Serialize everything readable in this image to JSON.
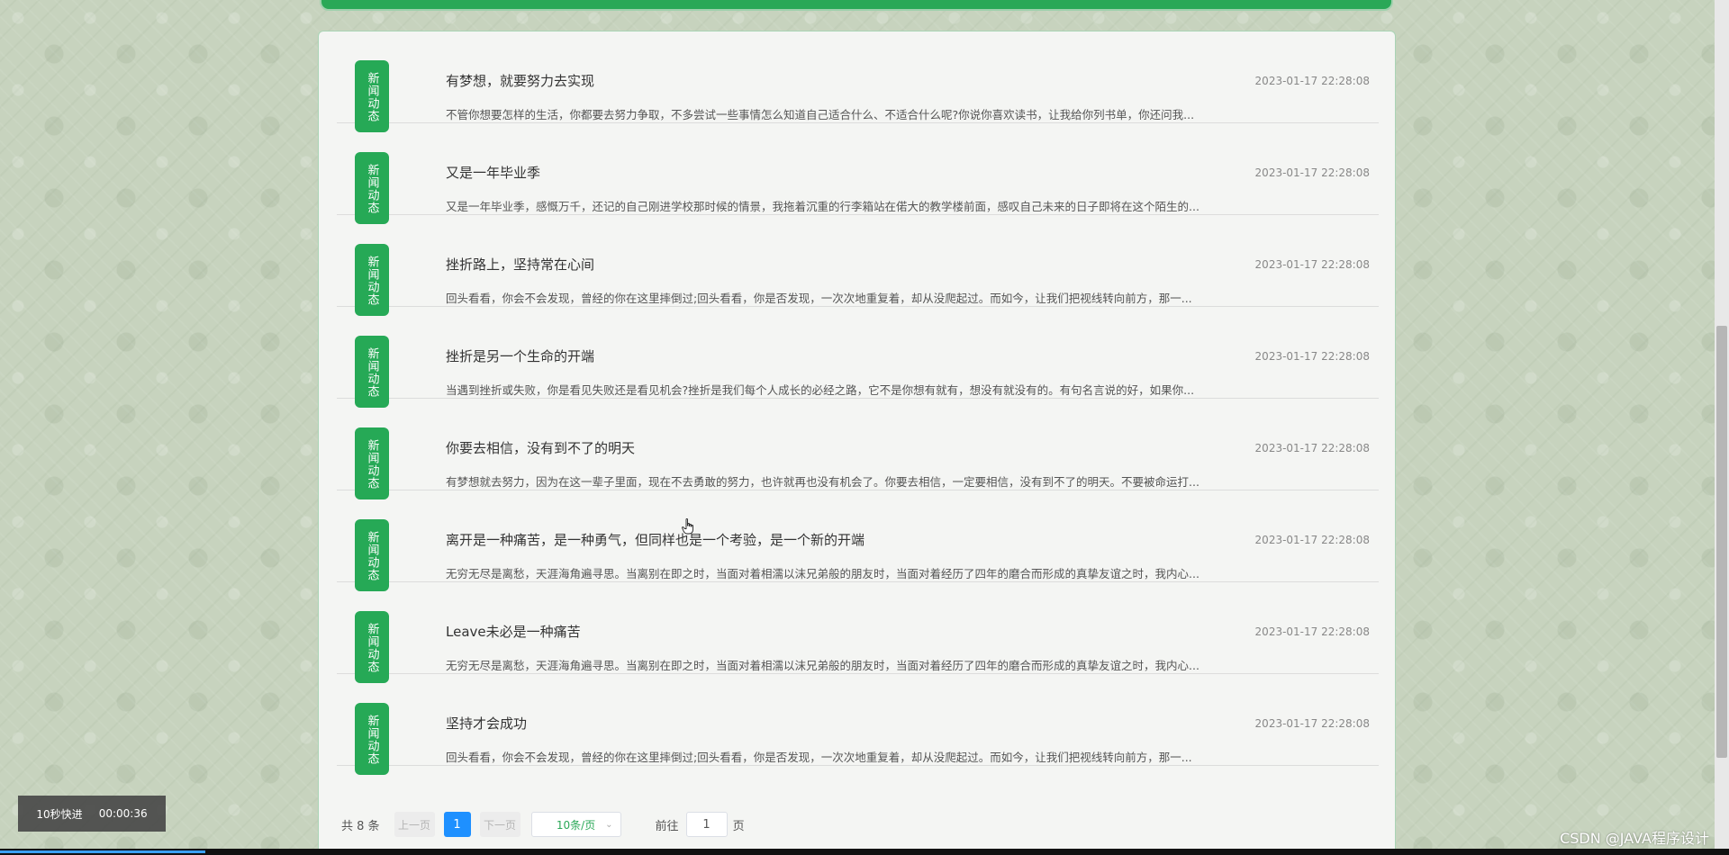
{
  "news": [
    {
      "badge": "新闻动态",
      "title": "有梦想，就要努力去实现",
      "date": "2023-01-17 22:28:08",
      "summary": "不管你想要怎样的生活，你都要去努力争取，不多尝试一些事情怎么知道自己适合什么、不适合什么呢?你说你喜欢读书，让我给你列书单，你还问我..."
    },
    {
      "badge": "新闻动态",
      "title": "又是一年毕业季",
      "date": "2023-01-17 22:28:08",
      "summary": "又是一年毕业季，感慨万千，还记的自己刚进学校那时候的情景，我拖着沉重的行李箱站在偌大的教学楼前面，感叹自己未来的日子即将在这个陌生的..."
    },
    {
      "badge": "新闻动态",
      "title": "挫折路上，坚持常在心间",
      "date": "2023-01-17 22:28:08",
      "summary": "回头看看，你会不会发现，曾经的你在这里摔倒过;回头看看，你是否发现，一次次地重复着，却从没爬起过。而如今，让我们把视线转向前方，那一..."
    },
    {
      "badge": "新闻动态",
      "title": "挫折是另一个生命的开端",
      "date": "2023-01-17 22:28:08",
      "summary": "当遇到挫折或失败，你是看见失败还是看见机会?挫折是我们每个人成长的必经之路，它不是你想有就有，想没有就没有的。有句名言说的好，如果你..."
    },
    {
      "badge": "新闻动态",
      "title": "你要去相信，没有到不了的明天",
      "date": "2023-01-17 22:28:08",
      "summary": "有梦想就去努力，因为在这一辈子里面，现在不去勇敢的努力，也许就再也没有机会了。你要去相信，一定要相信，没有到不了的明天。不要被命运打..."
    },
    {
      "badge": "新闻动态",
      "title": "离开是一种痛苦，是一种勇气，但同样也是一个考验，是一个新的开端",
      "date": "2023-01-17 22:28:08",
      "summary": "无穷无尽是离愁，天涯海角遍寻思。当离别在即之时，当面对着相濡以沫兄弟般的朋友时，当面对着经历了四年的磨合而形成的真挚友谊之时，我内心..."
    },
    {
      "badge": "新闻动态",
      "title": "Leave未必是一种痛苦",
      "date": "2023-01-17 22:28:08",
      "summary": "无穷无尽是离愁，天涯海角遍寻思。当离别在即之时，当面对着相濡以沫兄弟般的朋友时，当面对着经历了四年的磨合而形成的真挚友谊之时，我内心..."
    },
    {
      "badge": "新闻动态",
      "title": "坚持才会成功",
      "date": "2023-01-17 22:28:08",
      "summary": "回头看看，你会不会发现，曾经的你在这里摔倒过;回头看看，你是否发现，一次次地重复着，却从没爬起过。而如今，让我们把视线转向前方，那一..."
    }
  ],
  "pagination": {
    "total": "共 8 条",
    "prev": "上一页",
    "current": "1",
    "next": "下一页",
    "page_size": "10条/页",
    "goto_label": "前往",
    "goto_value": "1",
    "page_suffix": "页"
  },
  "video_tip": {
    "label": "10秒快进",
    "time": "00:00:36"
  },
  "watermark": "CSDN @JAVA程序设计",
  "colors": {
    "accent": "#26a956",
    "page_active": "#1e90ff",
    "background": "#c7d3be"
  }
}
